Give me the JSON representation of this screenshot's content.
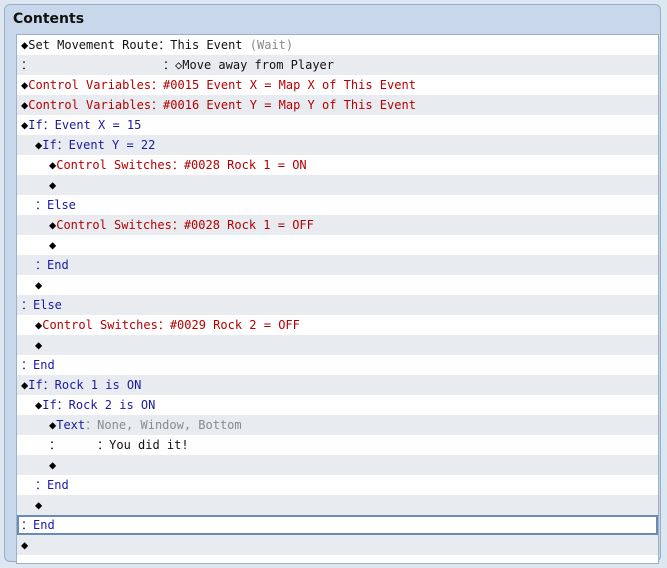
{
  "window": {
    "title": "Contents"
  },
  "rows": [
    {
      "indent": 1,
      "segments": [
        {
          "t": "◆",
          "c": "dia"
        },
        {
          "t": "Set Movement Route：",
          "c": "bl"
        },
        {
          "t": "This Event ",
          "c": "bl"
        },
        {
          "t": "(Wait)",
          "c": "g"
        }
      ]
    },
    {
      "indent": 1,
      "segments": [
        {
          "t": "：                  ：",
          "c": "bl"
        },
        {
          "t": "◇Move away from Player",
          "c": "bl"
        }
      ]
    },
    {
      "indent": 1,
      "segments": [
        {
          "t": "◆",
          "c": "dia"
        },
        {
          "t": "Control Variables：#0015 Event X = Map X of This Event",
          "c": "k"
        }
      ]
    },
    {
      "indent": 1,
      "segments": [
        {
          "t": "◆",
          "c": "dia"
        },
        {
          "t": "Control Variables：#0016 Event Y = Map Y of This Event",
          "c": "k"
        }
      ]
    },
    {
      "indent": 1,
      "segments": [
        {
          "t": "◆",
          "c": "dia"
        },
        {
          "t": "If：Event X = 15",
          "c": "b"
        }
      ]
    },
    {
      "indent": 2,
      "segments": [
        {
          "t": "◆",
          "c": "dia"
        },
        {
          "t": "If：Event Y = 22",
          "c": "b"
        }
      ]
    },
    {
      "indent": 3,
      "segments": [
        {
          "t": "◆",
          "c": "dia"
        },
        {
          "t": "Control Switches：#0028 Rock 1 = ON",
          "c": "k"
        }
      ]
    },
    {
      "indent": 3,
      "segments": [
        {
          "t": "◆",
          "c": "dia"
        }
      ]
    },
    {
      "indent": 2,
      "segments": [
        {
          "t": "：Else",
          "c": "b"
        }
      ]
    },
    {
      "indent": 3,
      "segments": [
        {
          "t": "◆",
          "c": "dia"
        },
        {
          "t": "Control Switches：#0028 Rock 1 = OFF",
          "c": "k"
        }
      ]
    },
    {
      "indent": 3,
      "segments": [
        {
          "t": "◆",
          "c": "dia"
        }
      ]
    },
    {
      "indent": 2,
      "segments": [
        {
          "t": "：End",
          "c": "b"
        }
      ]
    },
    {
      "indent": 2,
      "segments": [
        {
          "t": "◆",
          "c": "dia"
        }
      ]
    },
    {
      "indent": 1,
      "segments": [
        {
          "t": "：Else",
          "c": "b"
        }
      ]
    },
    {
      "indent": 2,
      "segments": [
        {
          "t": "◆",
          "c": "dia"
        },
        {
          "t": "Control Switches：#0029 Rock 2 = OFF",
          "c": "k"
        }
      ]
    },
    {
      "indent": 2,
      "segments": [
        {
          "t": "◆",
          "c": "dia"
        }
      ]
    },
    {
      "indent": 1,
      "segments": [
        {
          "t": "：End",
          "c": "b"
        }
      ]
    },
    {
      "indent": 1,
      "segments": [
        {
          "t": "◆",
          "c": "dia"
        },
        {
          "t": "If：Rock 1 is ON",
          "c": "b"
        }
      ]
    },
    {
      "indent": 2,
      "segments": [
        {
          "t": "◆",
          "c": "dia"
        },
        {
          "t": "If：Rock 2 is ON",
          "c": "b"
        }
      ]
    },
    {
      "indent": 3,
      "segments": [
        {
          "t": "◆",
          "c": "dia"
        },
        {
          "t": "Text",
          "c": "b"
        },
        {
          "t": "：None, Window, Bottom",
          "c": "g"
        }
      ]
    },
    {
      "indent": 3,
      "segments": [
        {
          "t": "：     ：",
          "c": "bl"
        },
        {
          "t": "You did it!",
          "c": "bl"
        }
      ]
    },
    {
      "indent": 3,
      "segments": [
        {
          "t": "◆",
          "c": "dia"
        }
      ]
    },
    {
      "indent": 2,
      "segments": [
        {
          "t": "：End",
          "c": "b"
        }
      ]
    },
    {
      "indent": 2,
      "segments": [
        {
          "t": "◆",
          "c": "dia"
        }
      ]
    },
    {
      "indent": 1,
      "segments": [
        {
          "t": "：End",
          "c": "b"
        }
      ],
      "selected": true
    },
    {
      "indent": 1,
      "segments": [
        {
          "t": "◆",
          "c": "dia"
        }
      ]
    }
  ]
}
